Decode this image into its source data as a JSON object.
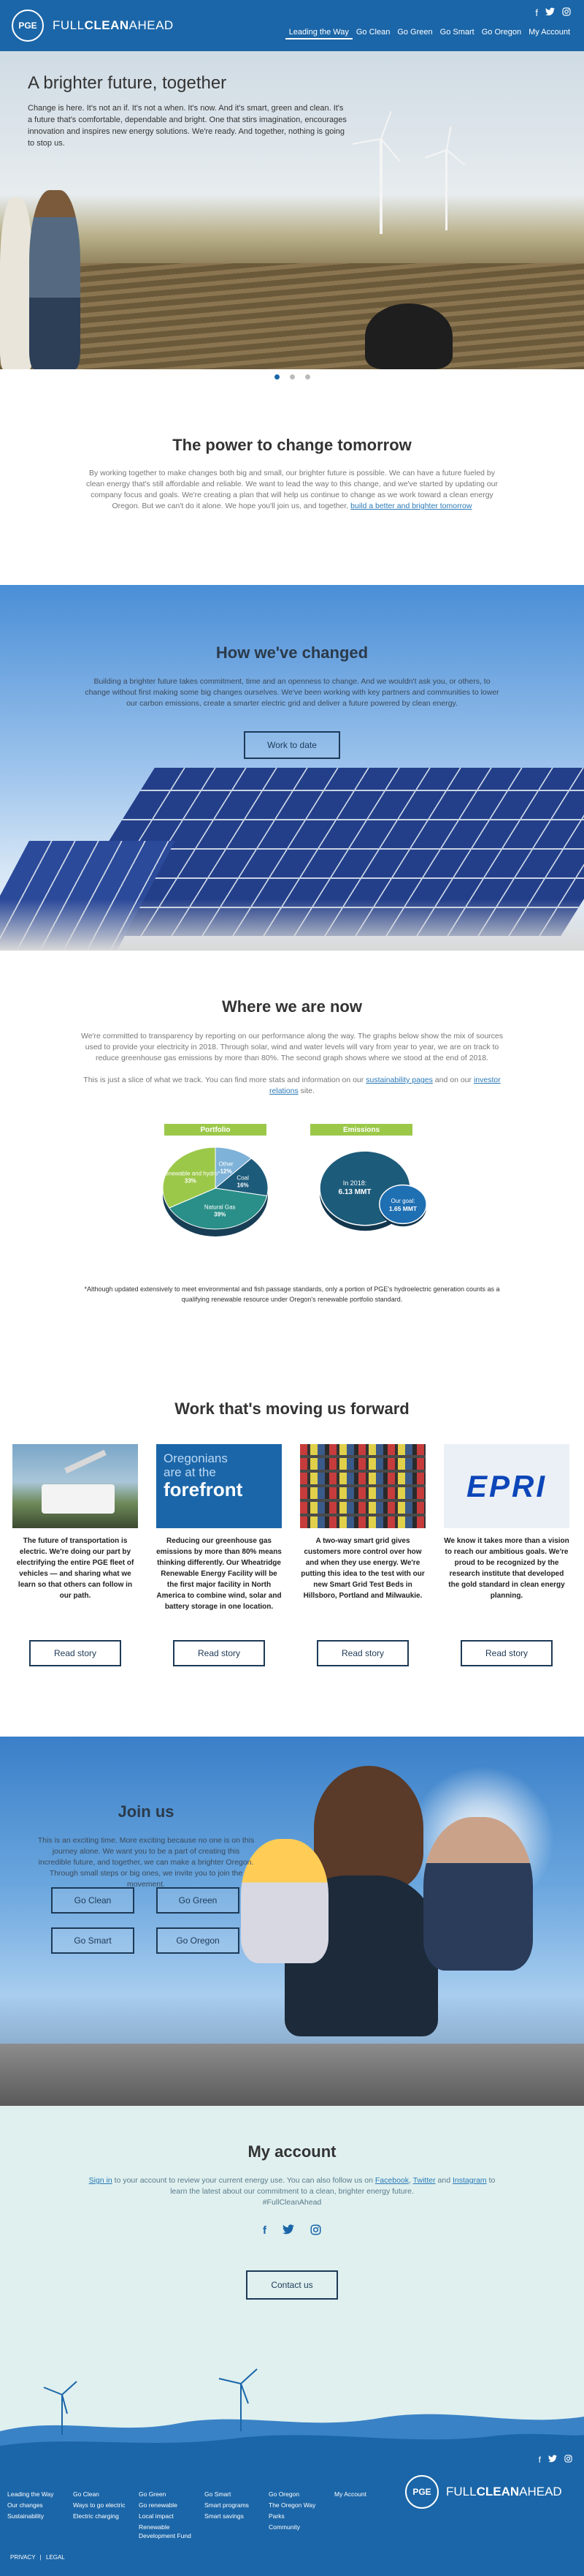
{
  "header": {
    "logo_text": "PGE",
    "brand_light": "FULL",
    "brand_bold": "CLEAN",
    "brand_light2": "AHEAD",
    "nav": [
      "Leading the Way",
      "Go Clean",
      "Go Green",
      "Go Smart",
      "Go Oregon",
      "My Account"
    ]
  },
  "hero": {
    "title": "A brighter future, together",
    "body": "Change is here. It's not an if. It's not a when. It's now. And it's smart, green and clean. It's a future that's comfortable, dependable and bright. One that stirs imagination, encourages innovation and inspires new energy solutions. We're ready. And together, nothing is going to stop us."
  },
  "power": {
    "title": "The power to change tomorrow",
    "body": "By working together to make changes both big and small, our brighter future is possible. We can have a future fueled by clean energy that's still affordable and reliable. We want to lead the way to this change, and we've started by updating our company focus and goals. We're creating a plan that will help us continue to change as we work toward a clean energy Oregon. But we can't do it alone. We hope you'll join us, and together,",
    "link": "build a better and brighter tomorrow"
  },
  "changed": {
    "title": "How we've changed",
    "body": "Building a brighter future takes commitment, time and an openness to change. And we wouldn't ask you, or others, to change without first making some big changes ourselves. We've been working with key partners and communities to lower our carbon emissions, create a smarter electric grid and deliver a future powered by clean energy.",
    "button": "Work to date"
  },
  "now": {
    "title": "Where we are now",
    "body": "We're committed to transparency by reporting on our performance along the way. The graphs below show the mix of sources used to provide your electricity in 2018. Through solar, wind and water levels will vary from year to year, we are on track to reduce greenhouse gas emissions by more than 80%. The second graph shows where we stood at the end of 2018.",
    "body2_pre": "This is just a slice of what we track. You can find more stats and information on our",
    "link1": "sustainability pages",
    "body2_mid": "and on our",
    "link2": "investor relations",
    "body2_post": "site.",
    "footnote": "*Although updated extensively to meet environmental and fish passage standards, only a portion of PGE's hydroelectric generation counts as a qualifying renewable resource under Oregon's renewable portfolio standard."
  },
  "chart_data": [
    {
      "type": "pie",
      "title": "Portfolio",
      "labels": [
        "Other",
        "Coal",
        "Natural Gas",
        "Renewable and hydro*"
      ],
      "values": [
        12,
        16,
        39,
        33
      ],
      "colors": [
        "#7fb2d8",
        "#1d5b7a",
        "#2a8f88",
        "#9cc84a"
      ]
    },
    {
      "type": "bubble",
      "title": "Emissions",
      "labels": [
        "In 2018:",
        "Our goal:"
      ],
      "values_text": [
        "6.13 MMT",
        "1.65 MMT"
      ],
      "values": [
        6.13,
        1.65
      ],
      "colors": [
        "#1d5b7a",
        "#1f6fb3"
      ]
    }
  ],
  "portfolio_labels": [
    {
      "name": "Other",
      "pct": "12%"
    },
    {
      "name": "Coal",
      "pct": "16%"
    },
    {
      "name": "Natural Gas",
      "pct": "39%"
    },
    {
      "name": "Renewable and hydro*",
      "pct": "33%"
    }
  ],
  "emissions_labels": {
    "y2018_label": "In 2018:",
    "y2018_value": "6.13 MMT",
    "goal_label": "Our goal:",
    "goal_value": "1.65 MMT"
  },
  "work": {
    "title": "Work that's moving us forward",
    "cards": [
      {
        "text": "The future of transportation is electric. We're doing our part by electrifying the entire PGE fleet of vehicles — and sharing what we learn so that others can follow in our path.",
        "button": "Read story"
      },
      {
        "text": "Reducing our greenhouse gas emissions by more than 80% means thinking differently. Our Wheatridge Renewable Energy Facility will be the first major facility in North America to combine wind, solar and battery storage in one location.",
        "button": "Read story",
        "img_line1": "Oregonians",
        "img_line2": "are at the",
        "img_line3": "forefront"
      },
      {
        "text": "A two-way smart grid gives customers more control over how and when they use energy. We're putting this idea to the test with our new Smart Grid Test Beds in Hillsboro, Portland and Milwaukie.",
        "button": "Read story"
      },
      {
        "text": "We know it takes more than a vision to reach our ambitious goals. We're proud to be recognized by the research institute that developed the gold standard in clean energy planning.",
        "button": "Read story",
        "img_logo": "EPRI"
      }
    ]
  },
  "join": {
    "title": "Join us",
    "body": "This is an exciting time. More exciting because no one is on this journey alone. We want you to be a part of creating this incredible future, and together, we can make a brighter Oregon. Through small steps or big ones, we invite you to join the movement.",
    "buttons": [
      "Go Clean",
      "Go Green",
      "Go Smart",
      "Go Oregon"
    ]
  },
  "account": {
    "title": "My account",
    "link1": "Sign in",
    "body1": "to your account to review your current energy use. You can also follow us on",
    "link2": "Facebook",
    "sep": ",",
    "link3": "Twitter",
    "and": "and",
    "link4": "Instagram",
    "body2": "to learn the latest about our commitment to a clean, brighter energy future.",
    "hashtag": "#FullCleanAhead",
    "button": "Contact us"
  },
  "footer": {
    "cols": [
      [
        "Leading the Way",
        "Our changes",
        "Sustainability"
      ],
      [
        "Go Clean",
        "Ways to go electric",
        "Electric charging"
      ],
      [
        "Go Green",
        "Go renewable",
        "Local impact",
        "Renewable Development Fund"
      ],
      [
        "Go Smart",
        "Smart programs",
        "Smart savings"
      ],
      [
        "Go Oregon",
        "The Oregon Way",
        "Parks",
        "Community"
      ],
      [
        "My Account"
      ]
    ],
    "brand_light": "FULL",
    "brand_bold": "CLEAN",
    "brand_light2": "AHEAD",
    "logo_text": "PGE",
    "legal": [
      "PRIVACY",
      "LEGAL"
    ],
    "legal_sep": "|"
  }
}
